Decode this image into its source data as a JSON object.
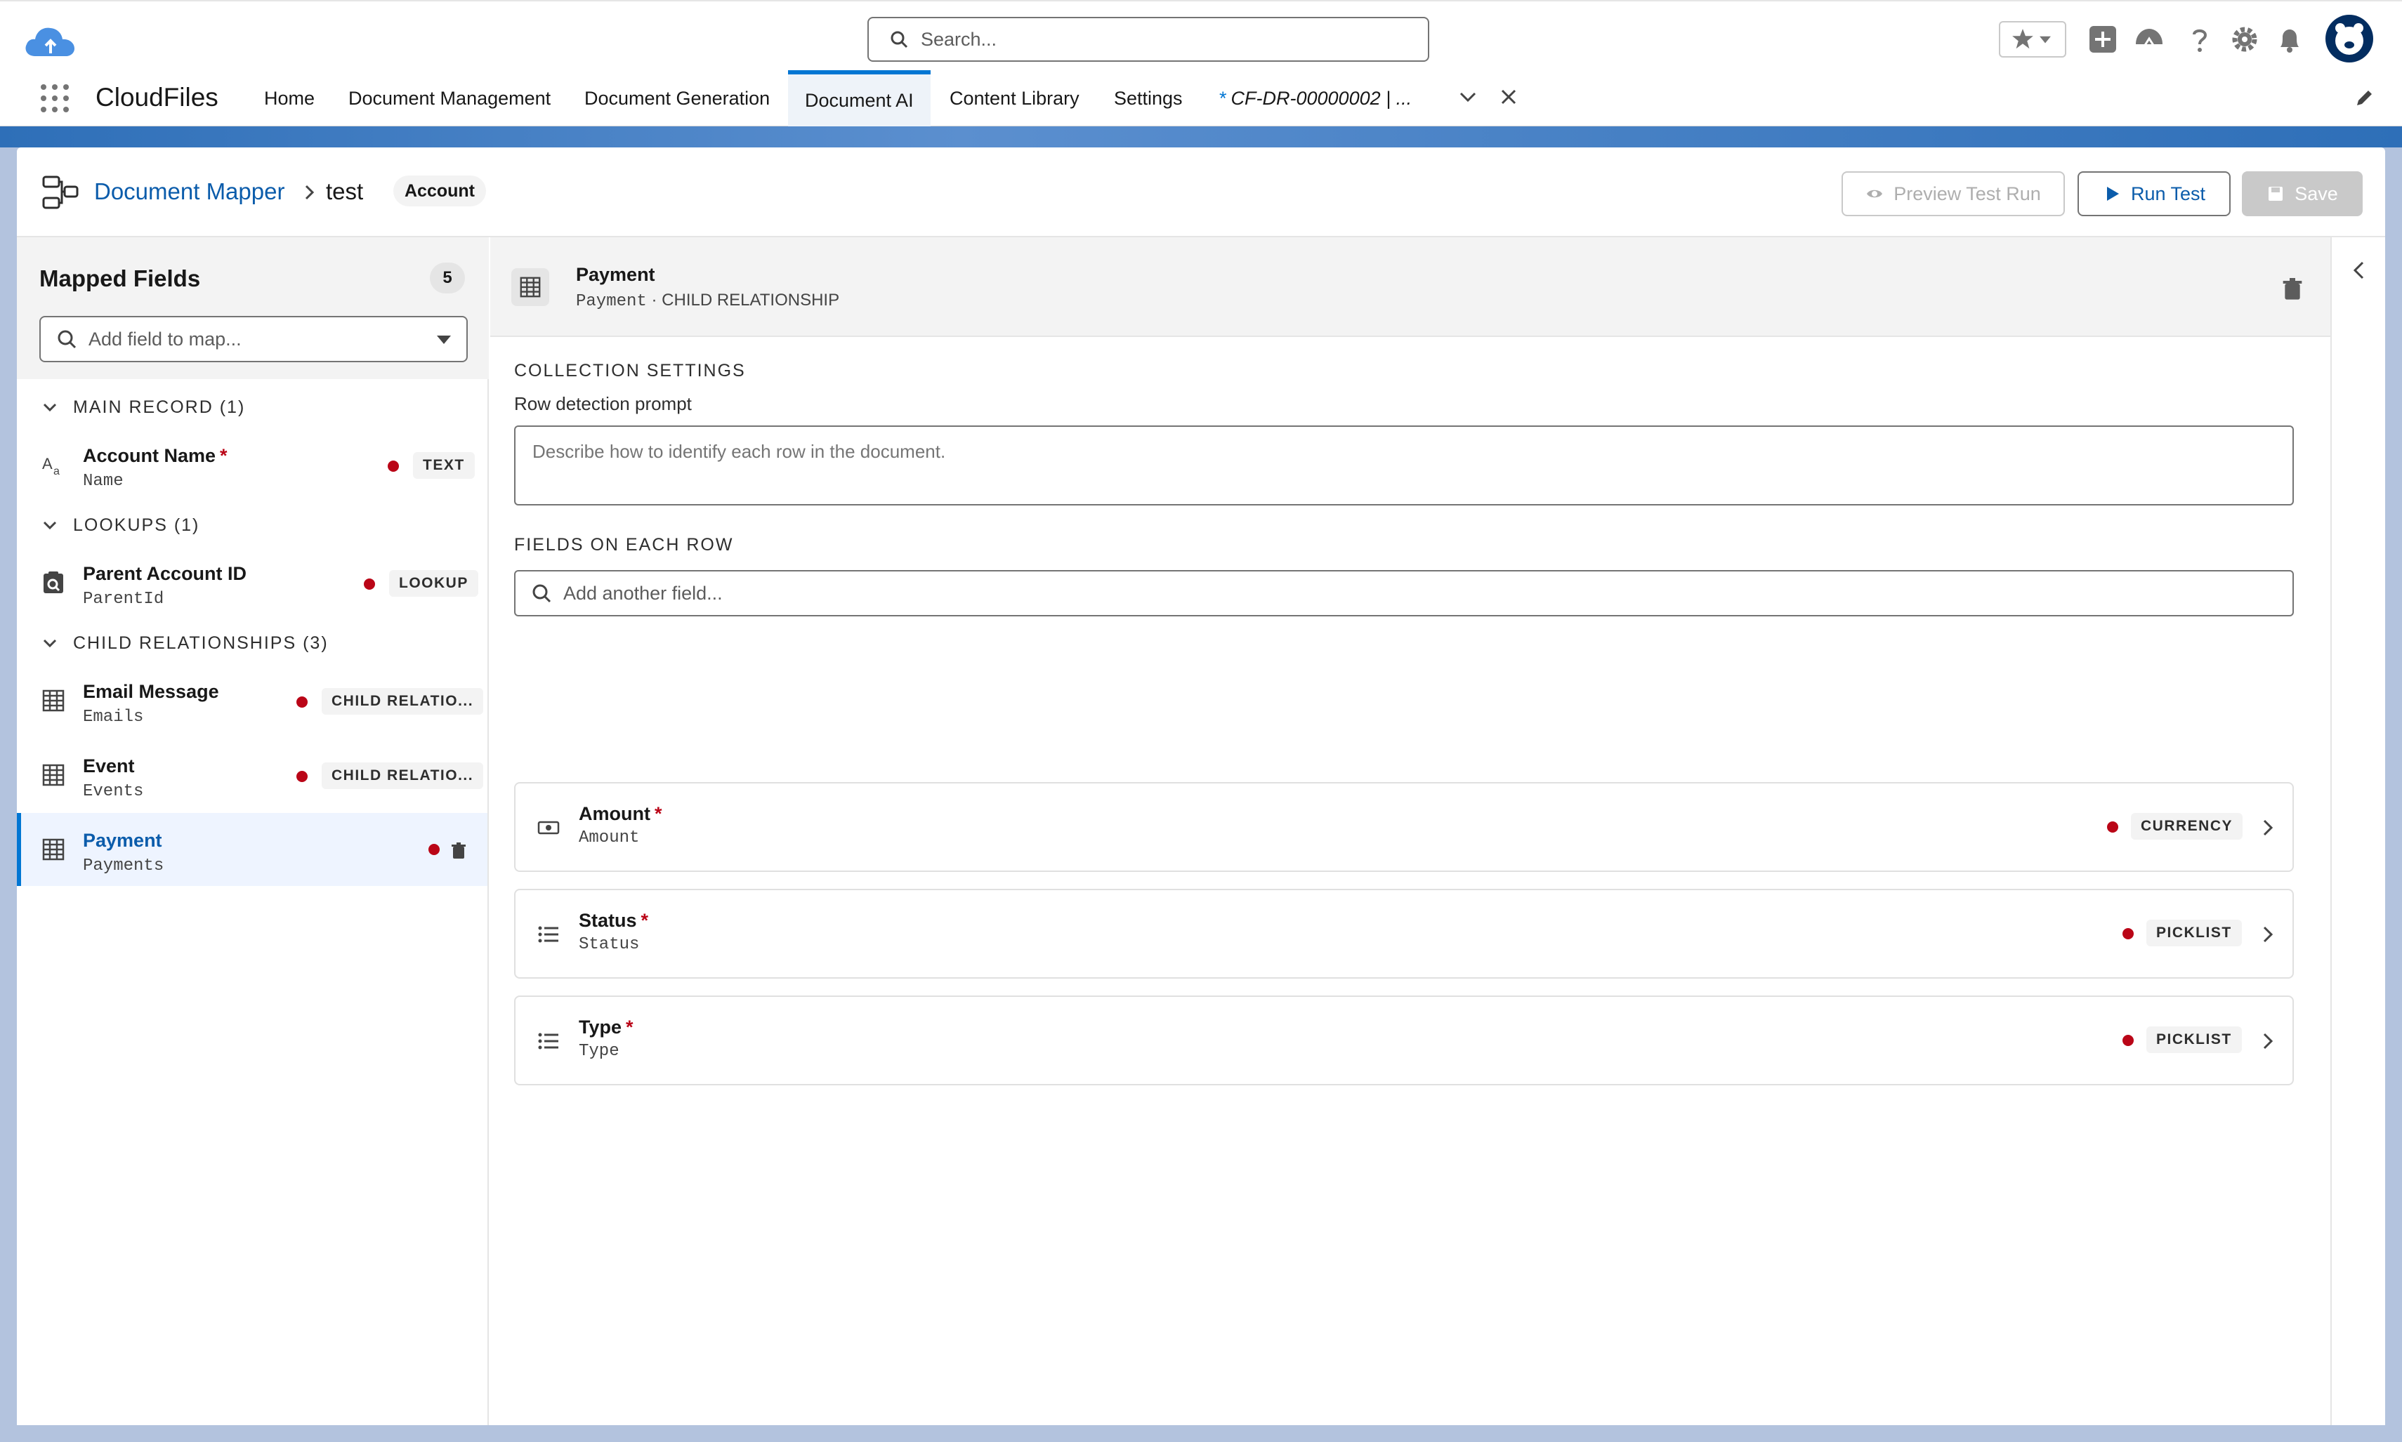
{
  "global": {
    "search_placeholder": "Search...",
    "icons": [
      "favorites-star-icon",
      "favorites-menu-icon",
      "global-add-icon",
      "trailhead-icon",
      "help-icon",
      "setup-gear-icon",
      "notifications-bell-icon",
      "user-avatar"
    ]
  },
  "app": {
    "name": "CloudFiles",
    "tabs": [
      {
        "label": "Home"
      },
      {
        "label": "Document Management"
      },
      {
        "label": "Document Generation"
      },
      {
        "label": "Document AI",
        "active": true
      },
      {
        "label": "Content Library"
      },
      {
        "label": "Settings"
      }
    ],
    "workspace_tab": {
      "dirty": "*",
      "label": "CF-DR-00000002 | ..."
    }
  },
  "header": {
    "breadcrumb_root": "Document Mapper",
    "breadcrumb_current": "test",
    "object_badge": "Account",
    "buttons": {
      "preview": "Preview Test Run",
      "run": "Run Test",
      "save": "Save"
    }
  },
  "mapped_fields": {
    "title": "Mapped Fields",
    "count": "5",
    "search_placeholder": "Add field to map...",
    "sections": [
      {
        "label": "MAIN RECORD (1)",
        "items": [
          {
            "name": "Account Name",
            "required": "*",
            "api": "Name",
            "type": "TEXT",
            "icon": "text-field-icon"
          }
        ]
      },
      {
        "label": "LOOKUPS (1)",
        "items": [
          {
            "name": "Parent Account ID",
            "api": "ParentId",
            "type": "LOOKUP",
            "icon": "lookup-icon"
          }
        ]
      },
      {
        "label": "CHILD RELATIONSHIPS (3)",
        "items": [
          {
            "name": "Email Message",
            "api": "Emails",
            "type": "CHILD RELATIO...",
            "icon": "table-icon"
          },
          {
            "name": "Event",
            "api": "Events",
            "type": "CHILD RELATIO...",
            "icon": "table-icon"
          },
          {
            "name": "Payment",
            "api": "Payments",
            "selected": true,
            "icon": "table-icon"
          }
        ]
      }
    ]
  },
  "detail": {
    "title": "Payment",
    "api": "Payment",
    "separator": " · ",
    "kind": "CHILD RELATIONSHIP",
    "collection_settings_label": "COLLECTION SETTINGS",
    "row_prompt_label": "Row detection prompt",
    "row_prompt_placeholder": "Describe how to identify each row in the document.",
    "fields_label": "FIELDS ON EACH ROW",
    "add_field_placeholder": "Add another field...",
    "fields": [
      {
        "name": "Amount",
        "required": "*",
        "api": "Amount",
        "type": "CURRENCY",
        "icon": "currency-icon"
      },
      {
        "name": "Status",
        "required": "*",
        "api": "Status",
        "type": "PICKLIST",
        "icon": "picklist-icon"
      },
      {
        "name": "Type",
        "required": "*",
        "api": "Type",
        "type": "PICKLIST",
        "icon": "picklist-icon"
      }
    ]
  },
  "colors": {
    "brand": "#0176d3",
    "link": "#0b5cab",
    "required": "#ba0517",
    "background_band": "#b3c3de"
  }
}
